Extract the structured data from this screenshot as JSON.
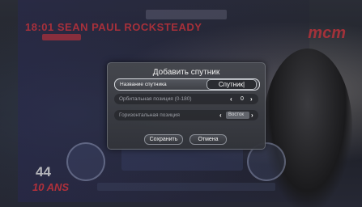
{
  "background": {
    "channel_title": "18:01 SEAN PAUL ROCKSTEADY",
    "channel_logo": "mcm",
    "show_number": "44",
    "show_subtitle": "10 ANS"
  },
  "dialog": {
    "title": "Добавить спутник",
    "name_label": "Название спутника",
    "name_value": "Спутник|",
    "orbital_label": "Орбитальная позиция (0-180)",
    "orbital_value": "0",
    "horizontal_label": "Горизонтальная позиция",
    "horizontal_value": "Восток",
    "save_label": "Сохранить",
    "cancel_label": "Отмена"
  },
  "icons": {
    "left_arrow": "‹",
    "right_arrow": "›"
  }
}
